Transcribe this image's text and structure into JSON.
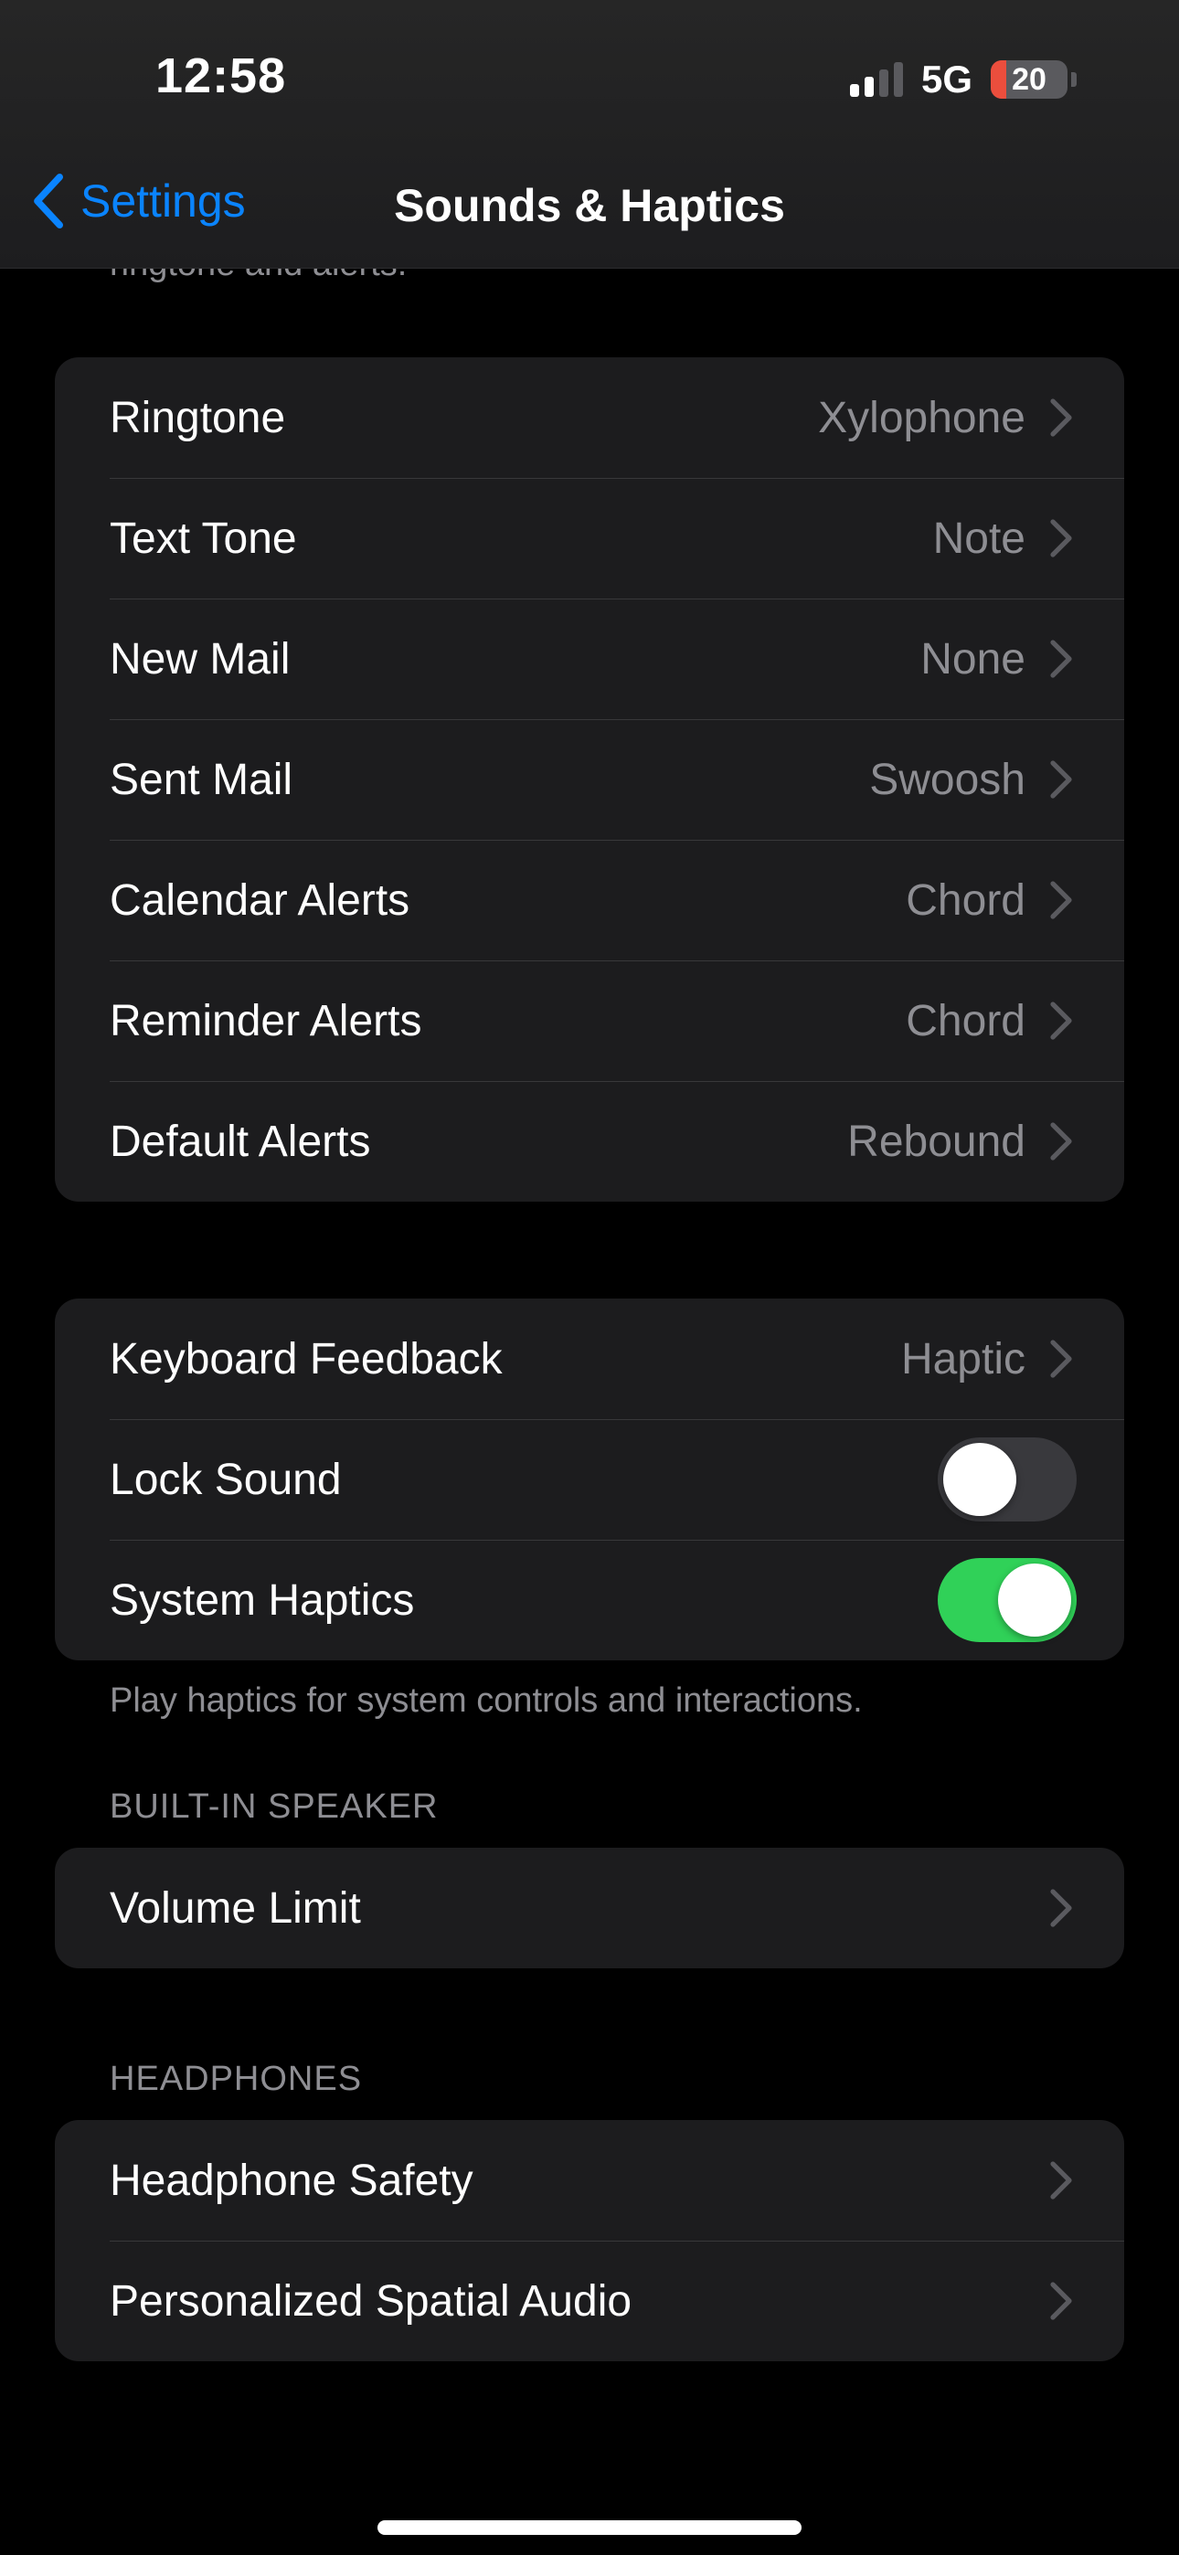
{
  "status_bar": {
    "time": "12:58",
    "network": "5G",
    "battery_level": 20,
    "battery_text": "20",
    "battery_color": "#eb4e3d",
    "signal_bars_active": 2,
    "signal_bars_total": 4
  },
  "nav": {
    "back_label": "Settings",
    "title": "Sounds & Haptics",
    "accent_color": "#0a84ff"
  },
  "clipped_note": "ringtone and alerts.",
  "sounds_group": {
    "items": [
      {
        "label": "Ringtone",
        "value": "Xylophone"
      },
      {
        "label": "Text Tone",
        "value": "Note"
      },
      {
        "label": "New Mail",
        "value": "None"
      },
      {
        "label": "Sent Mail",
        "value": "Swoosh"
      },
      {
        "label": "Calendar Alerts",
        "value": "Chord"
      },
      {
        "label": "Reminder Alerts",
        "value": "Chord"
      },
      {
        "label": "Default Alerts",
        "value": "Rebound"
      }
    ]
  },
  "feedback_group": {
    "keyboard_feedback": {
      "label": "Keyboard Feedback",
      "value": "Haptic"
    },
    "lock_sound": {
      "label": "Lock Sound",
      "on": false
    },
    "system_haptics": {
      "label": "System Haptics",
      "on": true
    },
    "footnote": "Play haptics for system controls and interactions."
  },
  "speaker_section": {
    "header": "BUILT-IN SPEAKER",
    "items": [
      {
        "label": "Volume Limit"
      }
    ]
  },
  "headphones_section": {
    "header": "HEADPHONES",
    "items": [
      {
        "label": "Headphone Safety"
      },
      {
        "label": "Personalized Spatial Audio"
      }
    ]
  },
  "colors": {
    "toggle_on": "#30d158",
    "toggle_off": "#39393d",
    "cell_background": "#1c1c1e",
    "secondary_text": "#8e8e93"
  },
  "icons": {
    "back": "chevron-left-icon",
    "disclosure": "chevron-right-icon"
  }
}
